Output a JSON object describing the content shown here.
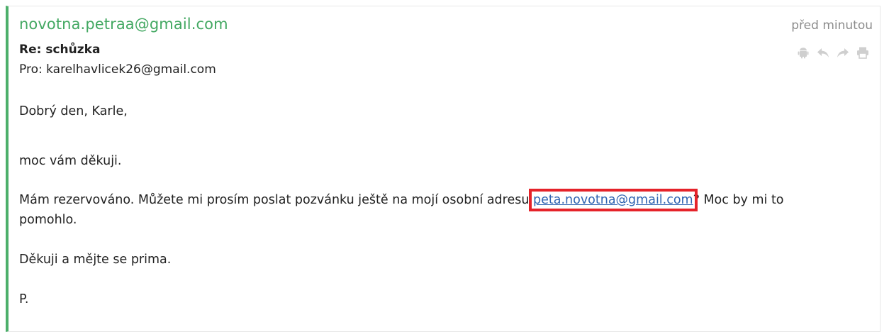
{
  "email": {
    "sender": "novotna.petraa@gmail.com",
    "time": "před minutou",
    "subject": "Re: schůzka",
    "recipient": "Pro: karelhavlicek26@gmail.com",
    "accent_color": "#4caf6a",
    "sender_color": "#43a862",
    "actions": [
      {
        "name": "android-icon"
      },
      {
        "name": "reply-icon"
      },
      {
        "name": "forward-icon"
      },
      {
        "name": "print-icon"
      }
    ],
    "body": {
      "greeting": "Dobrý den, Karle,",
      "thanks": "moc vám děkuji.",
      "request_before": "Mám rezervováno. Můžete mi prosím poslat pozvánku ještě na mojí osobní adresu ",
      "link": "peta.novotna@gmail.com",
      "request_after": "? Moc by mi to pomohlo.",
      "closing": "Děkuji a mějte se prima.",
      "signature": "P."
    },
    "highlight_color": "#e5232a",
    "link_color": "#2f64b1"
  }
}
